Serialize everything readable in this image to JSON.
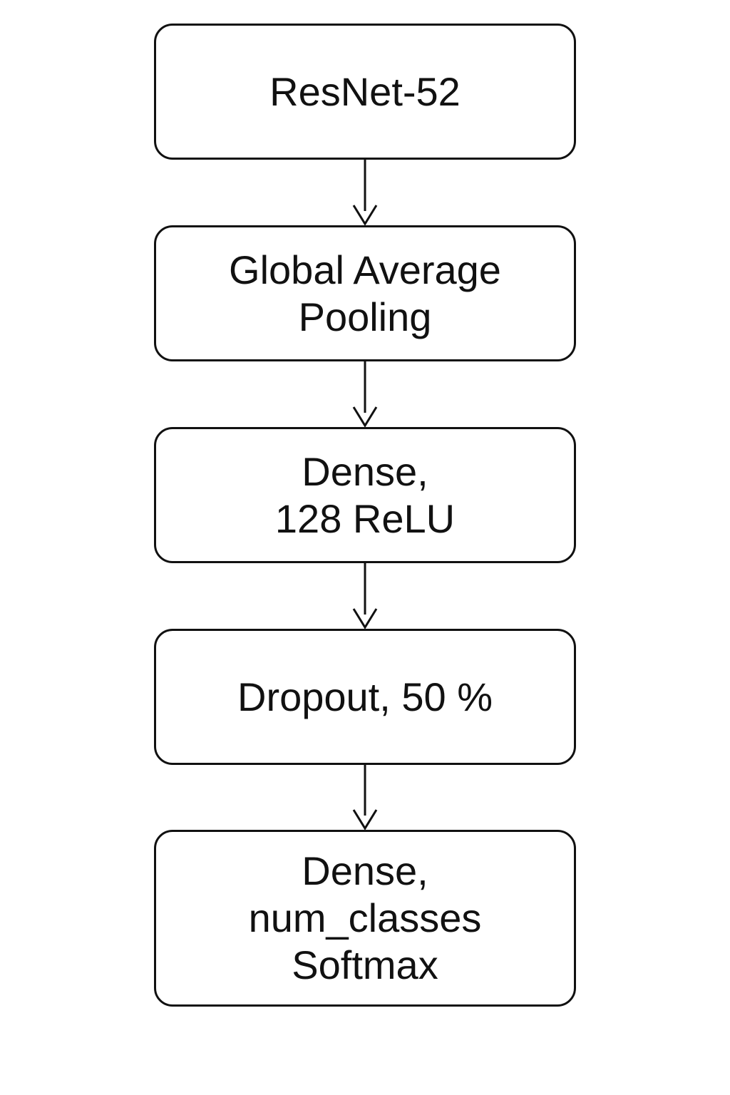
{
  "diagram": {
    "colors": {
      "stroke": "#111111",
      "text": "#111111",
      "background": "#ffffff"
    },
    "nodes": [
      {
        "id": "resnet",
        "lines": [
          "ResNet-52"
        ]
      },
      {
        "id": "gap",
        "lines": [
          "Global Average",
          "Pooling"
        ]
      },
      {
        "id": "dense-relu",
        "lines": [
          "Dense,",
          "128 ReLU"
        ]
      },
      {
        "id": "dropout",
        "lines": [
          "Dropout, 50 %"
        ]
      },
      {
        "id": "dense-softmax",
        "lines": [
          "Dense,",
          "num_classes",
          "Softmax"
        ]
      }
    ],
    "edges": [
      {
        "from": "resnet",
        "to": "gap"
      },
      {
        "from": "gap",
        "to": "dense-relu"
      },
      {
        "from": "dense-relu",
        "to": "dropout"
      },
      {
        "from": "dropout",
        "to": "dense-softmax"
      }
    ]
  }
}
